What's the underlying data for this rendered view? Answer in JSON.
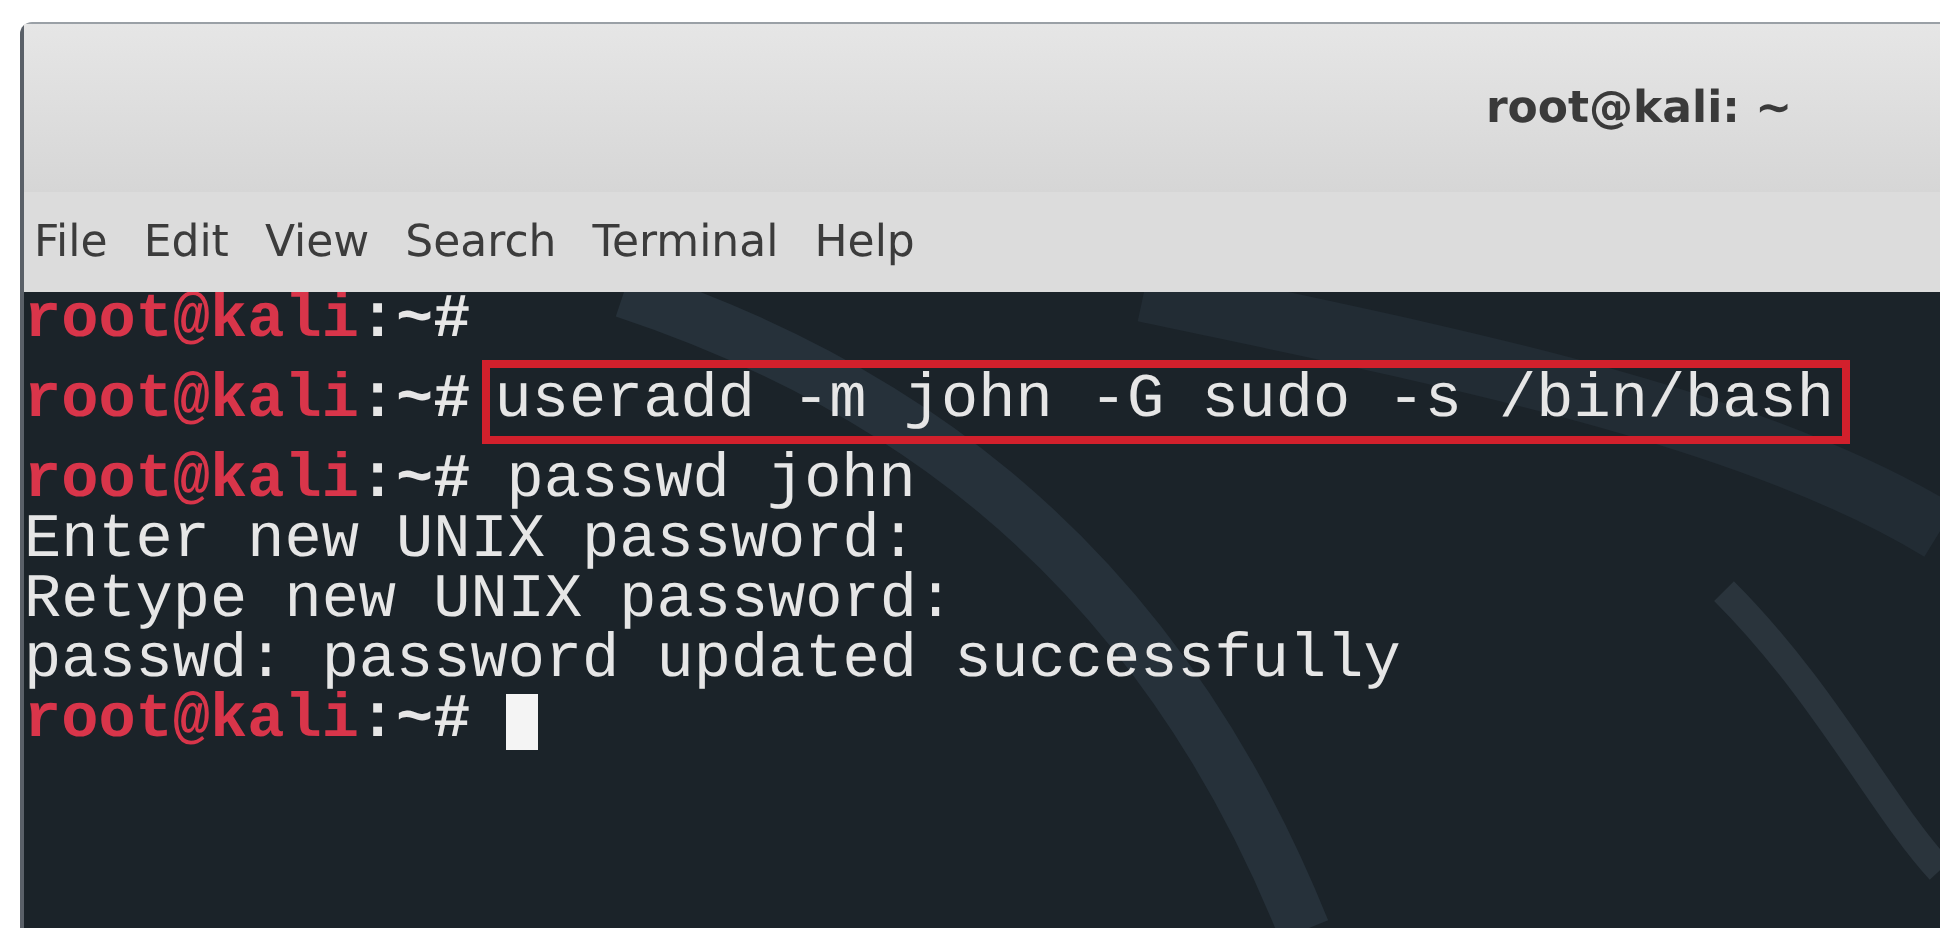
{
  "window": {
    "title": "root@kali: ~"
  },
  "menu": [
    {
      "label": "File"
    },
    {
      "label": "Edit"
    },
    {
      "label": "View"
    },
    {
      "label": "Search"
    },
    {
      "label": "Terminal"
    },
    {
      "label": "Help"
    }
  ],
  "terminal": {
    "lines": [
      {
        "kind": "prompt",
        "user": "root@kali",
        "path": ":~#",
        "highlighted": false,
        "cursor": false
      },
      {
        "kind": "prompt",
        "user": "root@kali",
        "path": ":~#",
        "command": "useradd -m john -G sudo -s /bin/bash",
        "highlighted": true,
        "cursor": false
      },
      {
        "kind": "prompt",
        "user": "root@kali",
        "path": ":~#",
        "command": "passwd john",
        "highlighted": false,
        "cursor": false
      },
      {
        "kind": "output",
        "text": "Enter new UNIX password:"
      },
      {
        "kind": "output",
        "text": "Retype new UNIX password:"
      },
      {
        "kind": "output",
        "text": "passwd: password updated successfully"
      },
      {
        "kind": "prompt",
        "user": "root@kali",
        "path": ":~#",
        "highlighted": false,
        "cursor": true
      }
    ]
  }
}
